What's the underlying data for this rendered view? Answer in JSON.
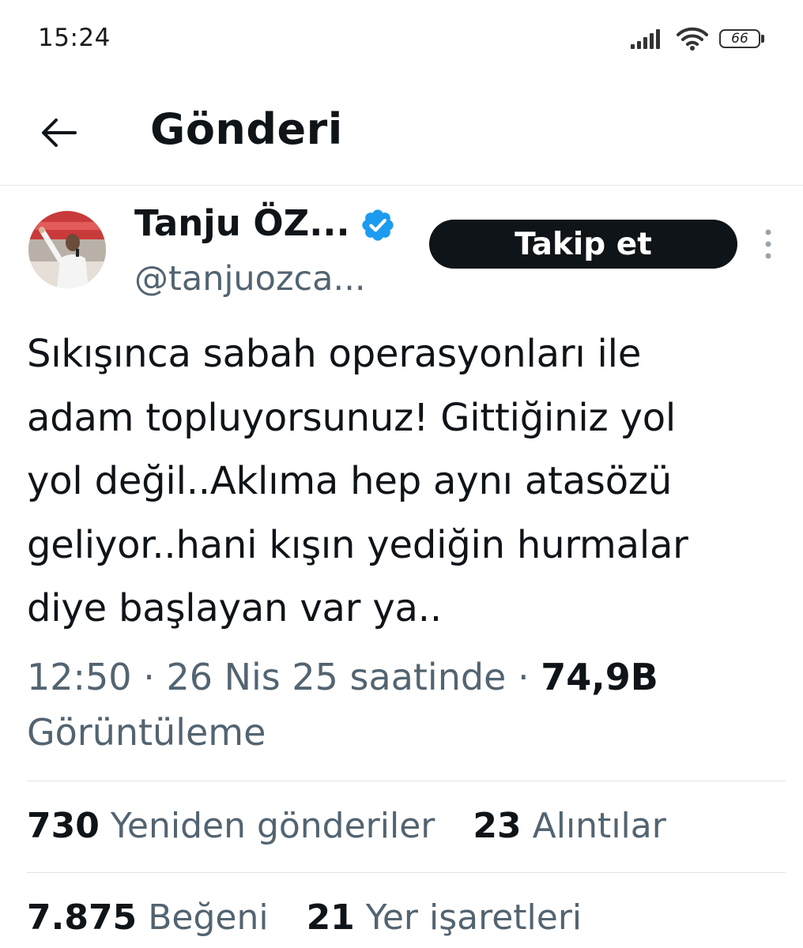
{
  "status_bar": {
    "time": "15:24",
    "battery": "66",
    "icons": [
      "signal-icon",
      "wifi-icon",
      "battery-icon"
    ]
  },
  "header": {
    "title": "Gönderi",
    "back_icon": "arrow-left-icon"
  },
  "tweet": {
    "author_name": "Tanju ÖZ...",
    "author_handle": "@tanjuozca...",
    "verified": true,
    "follow_label": "Takip et",
    "text": "Sıkışınca sabah operasyonları ile\nadam topluyorsunuz! Gittiğiniz yol\nyol değil..Aklıma hep aynı atasözü\ngeliyor..hani kışın yediğin hurmalar\ndiye başlayan var ya..",
    "time": "12:50",
    "date": "26 Nis 25 saatinde",
    "separator": "·",
    "views_count": "74,9B",
    "views_label": "Görüntüleme"
  },
  "stats": {
    "reposts_count": "730",
    "reposts_label": "Yeniden gönderiler",
    "quotes_count": "23",
    "quotes_label": "Alıntılar",
    "likes_count": "7.875",
    "likes_label": "Beğeni",
    "bookmarks_count": "21",
    "bookmarks_label": "Yer işaretleri"
  },
  "colors": {
    "text_primary": "#0f1419",
    "text_secondary": "#536471",
    "verified_blue": "#1d9bf0",
    "button_bg": "#0f1419",
    "divider": "#e1e4e8"
  }
}
